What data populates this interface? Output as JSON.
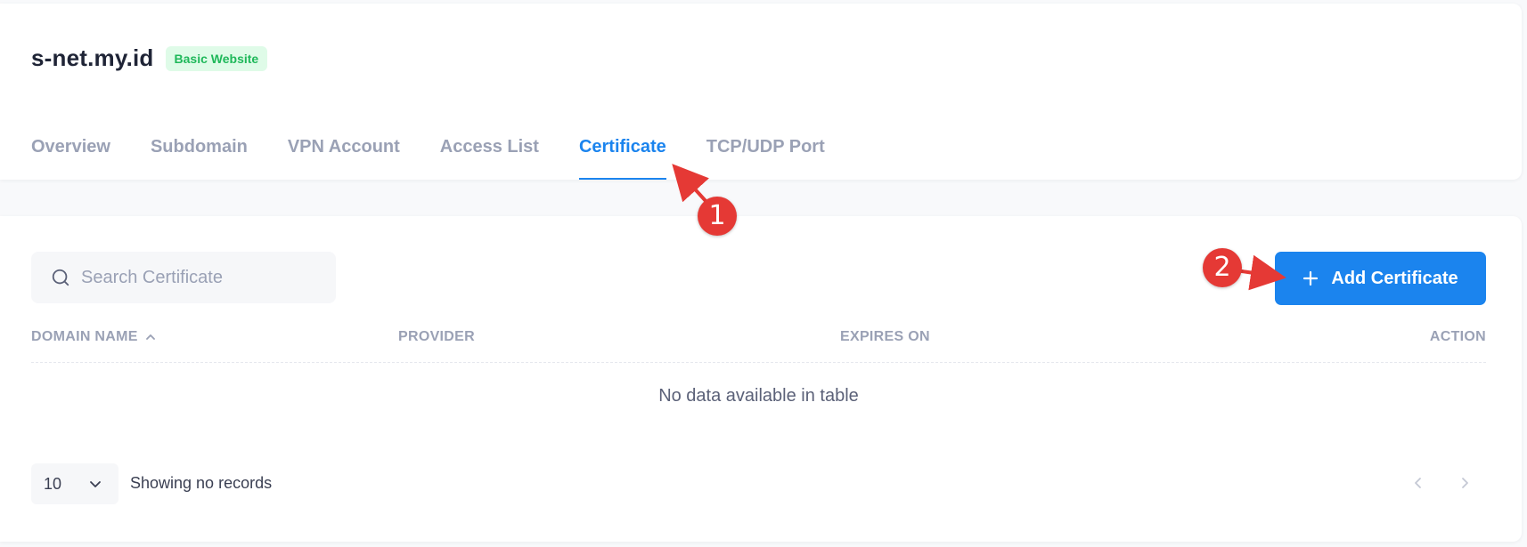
{
  "site": {
    "title": "s-net.my.id",
    "badge": "Basic Website"
  },
  "tabs": [
    {
      "label": "Overview",
      "active": false
    },
    {
      "label": "Subdomain",
      "active": false
    },
    {
      "label": "VPN Account",
      "active": false
    },
    {
      "label": "Access List",
      "active": false
    },
    {
      "label": "Certificate",
      "active": true
    },
    {
      "label": "TCP/UDP Port",
      "active": false
    }
  ],
  "search": {
    "placeholder": "Search Certificate",
    "value": ""
  },
  "toolbar": {
    "add_label": "Add Certificate"
  },
  "table": {
    "columns": [
      "DOMAIN NAME",
      "PROVIDER",
      "EXPIRES ON",
      "ACTION"
    ],
    "empty_message": "No data available in table"
  },
  "pagination": {
    "page_size": "10",
    "info": "Showing no records"
  },
  "annotations": {
    "step1": "1",
    "step2": "2"
  },
  "colors": {
    "accent": "#1b84ee",
    "badge_bg": "#dffbe8",
    "badge_text": "#1fb85a",
    "annotation": "#e53935"
  }
}
